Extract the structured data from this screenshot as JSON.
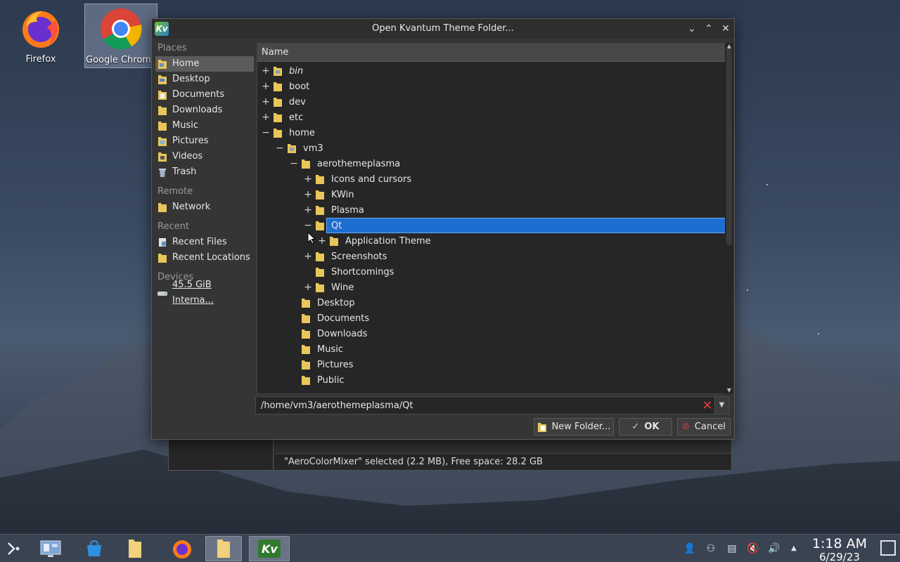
{
  "desktop": {
    "icons": [
      {
        "label": "Firefox",
        "icon": "firefox-icon"
      },
      {
        "label": "Google Chrome",
        "icon": "chrome-icon"
      }
    ]
  },
  "background_window": {
    "status": "\"AeroColorMixer\" selected (2.2 MB), Free space: 28.2 GB"
  },
  "dialog": {
    "title": "Open Kvantum Theme Folder...",
    "app_icon_text": "Kv",
    "places": {
      "sections": [
        {
          "title": "Places",
          "items": [
            "Home",
            "Desktop",
            "Documents",
            "Downloads",
            "Music",
            "Pictures",
            "Videos",
            "Trash"
          ]
        },
        {
          "title": "Remote",
          "items": [
            "Network"
          ]
        },
        {
          "title": "Recent",
          "items": [
            "Recent Files",
            "Recent Locations"
          ]
        },
        {
          "title": "Devices",
          "items": [
            "45.5 GiB Interna..."
          ]
        }
      ]
    },
    "tree": {
      "column_header": "Name",
      "rows": [
        {
          "label": "bin",
          "level": 0,
          "expander": "+",
          "italic": true
        },
        {
          "label": "boot",
          "level": 0,
          "expander": "+"
        },
        {
          "label": "dev",
          "level": 0,
          "expander": "+"
        },
        {
          "label": "etc",
          "level": 0,
          "expander": "+"
        },
        {
          "label": "home",
          "level": 0,
          "expander": "−"
        },
        {
          "label": "vm3",
          "level": 1,
          "expander": "−"
        },
        {
          "label": "aerothemeplasma",
          "level": 2,
          "expander": "−"
        },
        {
          "label": "Icons and cursors",
          "level": 3,
          "expander": "+"
        },
        {
          "label": "KWin",
          "level": 3,
          "expander": "+"
        },
        {
          "label": "Plasma",
          "level": 3,
          "expander": "+"
        },
        {
          "label": "Qt",
          "level": 3,
          "expander": "−",
          "selected": true
        },
        {
          "label": "Application Theme",
          "level": 4,
          "expander": "+"
        },
        {
          "label": "Screenshots",
          "level": 3,
          "expander": "+"
        },
        {
          "label": "Shortcomings",
          "level": 3,
          "expander": ""
        },
        {
          "label": "Wine",
          "level": 3,
          "expander": "+"
        },
        {
          "label": "Desktop",
          "level": 2,
          "expander": ""
        },
        {
          "label": "Documents",
          "level": 2,
          "expander": ""
        },
        {
          "label": "Downloads",
          "level": 2,
          "expander": ""
        },
        {
          "label": "Music",
          "level": 2,
          "expander": ""
        },
        {
          "label": "Pictures",
          "level": 2,
          "expander": ""
        },
        {
          "label": "Public",
          "level": 2,
          "expander": ""
        }
      ]
    },
    "path_value": "/home/vm3/aerothemeplasma/Qt",
    "buttons": {
      "new_folder": "New Folder...",
      "ok": "OK",
      "cancel": "Cancel"
    }
  },
  "taskbar": {
    "clock_time": "1:18 AM",
    "clock_date": "6/29/23"
  }
}
